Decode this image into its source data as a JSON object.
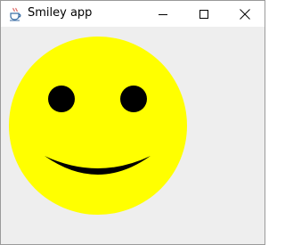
{
  "window": {
    "title": "Smiley app"
  },
  "icons": {
    "app": "java-coffee-cup-icon",
    "minimize": "minimize-icon",
    "maximize": "maximize-icon",
    "close": "close-icon"
  },
  "smiley": {
    "face_color": "#ffff00",
    "feature_color": "#000000",
    "background_color": "#eeeeee"
  }
}
